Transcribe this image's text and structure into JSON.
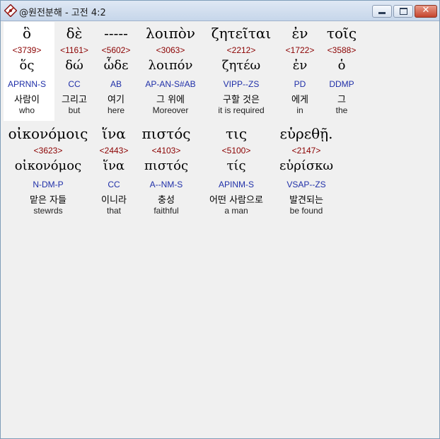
{
  "window": {
    "title": "@원전분해 - 고전 4:2"
  },
  "rows": [
    [
      {
        "greek": "ὃ",
        "strong": "<3739>",
        "lemma": "ὅς",
        "parse": "APRNN-S",
        "korean": "사람이",
        "english": "who"
      },
      {
        "greek": "δὲ",
        "strong": "<1161>",
        "lemma": "δώ",
        "parse": "CC",
        "korean": "그리고",
        "english": "but"
      },
      {
        "greek": "-----",
        "strong": "<5602>",
        "lemma": "ὧδε",
        "parse": "AB",
        "korean": "여기",
        "english": "here"
      },
      {
        "greek": "λοιπὸν",
        "strong": "<3063>",
        "lemma": "λοιπόν",
        "parse": "AP-AN-S#AB",
        "korean": "그 위에",
        "english": "Moreover"
      },
      {
        "greek": "ζητεῖται",
        "strong": "<2212>",
        "lemma": "ζητέω",
        "parse": "VIPP--ZS",
        "korean": "구할 것은",
        "english": "it is required"
      },
      {
        "greek": "ἐν",
        "strong": "<1722>",
        "lemma": "ἐν",
        "parse": "PD",
        "korean": "에게",
        "english": "in"
      },
      {
        "greek": "τοῖς",
        "strong": "<3588>",
        "lemma": "ὁ",
        "parse": "DDMP",
        "korean": "그",
        "english": "the"
      }
    ],
    [
      {
        "greek": "οἰκονόμοις",
        "strong": "<3623>",
        "lemma": "οἰκονόμος",
        "parse": "N-DM-P",
        "korean": "맡은 자들",
        "english": "stewrds"
      },
      {
        "greek": "ἵνα",
        "strong": "<2443>",
        "lemma": "ἵνα",
        "parse": "CC",
        "korean": "이니라",
        "english": "that"
      },
      {
        "greek": "πιστός",
        "strong": "<4103>",
        "lemma": "πιστός",
        "parse": "A--NM-S",
        "korean": "충성",
        "english": "faithful"
      },
      {
        "greek": "τις",
        "strong": "<5100>",
        "lemma": "τίς",
        "parse": "APINM-S",
        "korean": "어떤 사람으로",
        "english": "a man"
      },
      {
        "greek": "εὑρεθῇ.",
        "strong": "<2147>",
        "lemma": "εὑρίσκω",
        "parse": "VSAP--ZS",
        "korean": "발견되는",
        "english": "be found"
      }
    ]
  ]
}
